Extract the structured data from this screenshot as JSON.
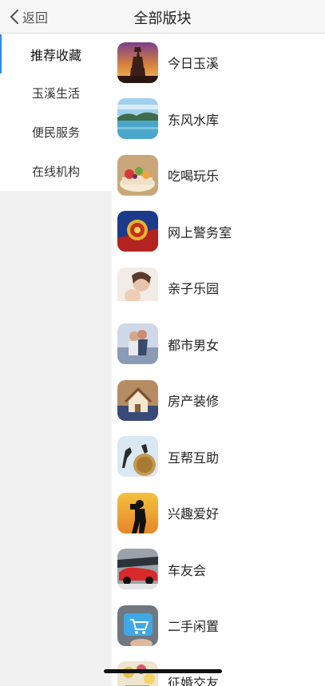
{
  "nav": {
    "back_label": "返回",
    "title": "全部版块"
  },
  "sidebar": {
    "items": [
      {
        "label": "推荐收藏",
        "active": true
      },
      {
        "label": "玉溪生活",
        "active": false
      },
      {
        "label": "便民服务",
        "active": false
      },
      {
        "label": "在线机构",
        "active": false
      }
    ]
  },
  "forums": [
    {
      "label": "今日玉溪",
      "icon": "pagoda-sunset-photo"
    },
    {
      "label": "东风水库",
      "icon": "reservoir-lake-photo"
    },
    {
      "label": "吃喝玩乐",
      "icon": "fruit-cake-photo"
    },
    {
      "label": "网上警务室",
      "icon": "police-badge-photo"
    },
    {
      "label": "亲子乐园",
      "icon": "mother-baby-photo"
    },
    {
      "label": "都市男女",
      "icon": "couple-photo"
    },
    {
      "label": "房产装修",
      "icon": "house-model-photo"
    },
    {
      "label": "互帮互助",
      "icon": "helping-hands-photo"
    },
    {
      "label": "兴趣爱好",
      "icon": "photographer-silhouette-photo"
    },
    {
      "label": "车友会",
      "icon": "cars-parking-photo"
    },
    {
      "label": "二手闲置",
      "icon": "shopping-cart-key-photo"
    },
    {
      "label": "征婚交友",
      "icon": "flowers-photo"
    }
  ]
}
